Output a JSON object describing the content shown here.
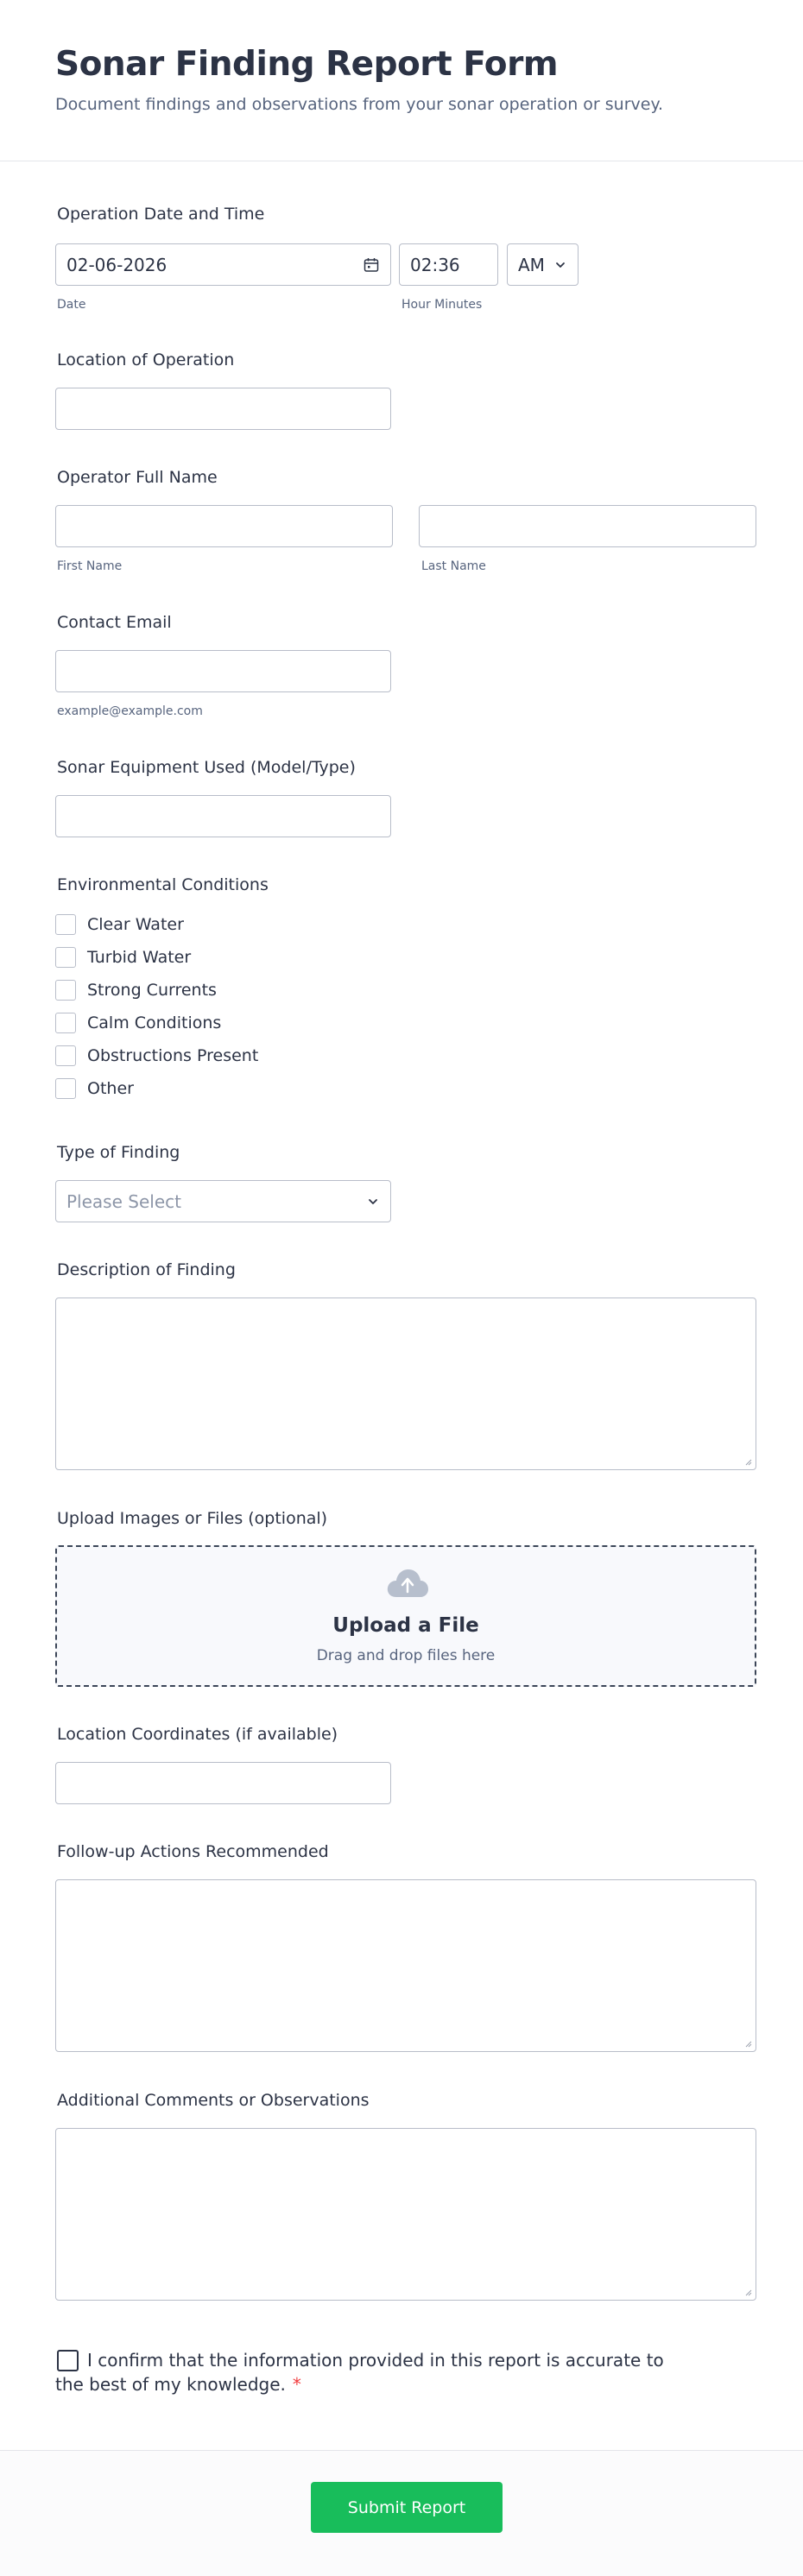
{
  "header": {
    "title": "Sonar Finding Report Form",
    "subtitle": "Document findings and observations from your sonar operation or survey."
  },
  "date_time": {
    "label": "Operation Date and Time",
    "date_value": "02-06-2026",
    "date_sublabel": "Date",
    "time_value": "02:36",
    "time_sublabel": "Hour Minutes",
    "ampm_value": "AM"
  },
  "location": {
    "label": "Location of Operation",
    "value": ""
  },
  "operator": {
    "label": "Operator Full Name",
    "first_sublabel": "First Name",
    "last_sublabel": "Last Name"
  },
  "email": {
    "label": "Contact Email",
    "sublabel": "example@example.com"
  },
  "equipment": {
    "label": "Sonar Equipment Used (Model/Type)"
  },
  "conditions": {
    "label": "Environmental Conditions",
    "options": [
      "Clear Water",
      "Turbid Water",
      "Strong Currents",
      "Calm Conditions",
      "Obstructions Present",
      "Other"
    ]
  },
  "finding_type": {
    "label": "Type of Finding",
    "placeholder": "Please Select"
  },
  "description": {
    "label": "Description of Finding"
  },
  "upload": {
    "label": "Upload Images or Files (optional)",
    "title": "Upload a File",
    "subtitle": "Drag and drop files here"
  },
  "coordinates": {
    "label": "Location Coordinates (if available)"
  },
  "followup": {
    "label": "Follow-up Actions Recommended"
  },
  "comments": {
    "label": "Additional Comments or Observations"
  },
  "confirm": {
    "text": "I confirm that the information provided in this report is accurate to the best of my knowledge.",
    "required_mark": "*"
  },
  "submit": {
    "label": "Submit Report"
  },
  "colors": {
    "accent": "#18bd5b",
    "required": "#f23a3c",
    "text": "#2c3345",
    "muted": "#57647e"
  },
  "icons": {
    "date": "calendar-icon",
    "select": "chevron-down-icon",
    "upload": "cloud-upload-icon"
  }
}
